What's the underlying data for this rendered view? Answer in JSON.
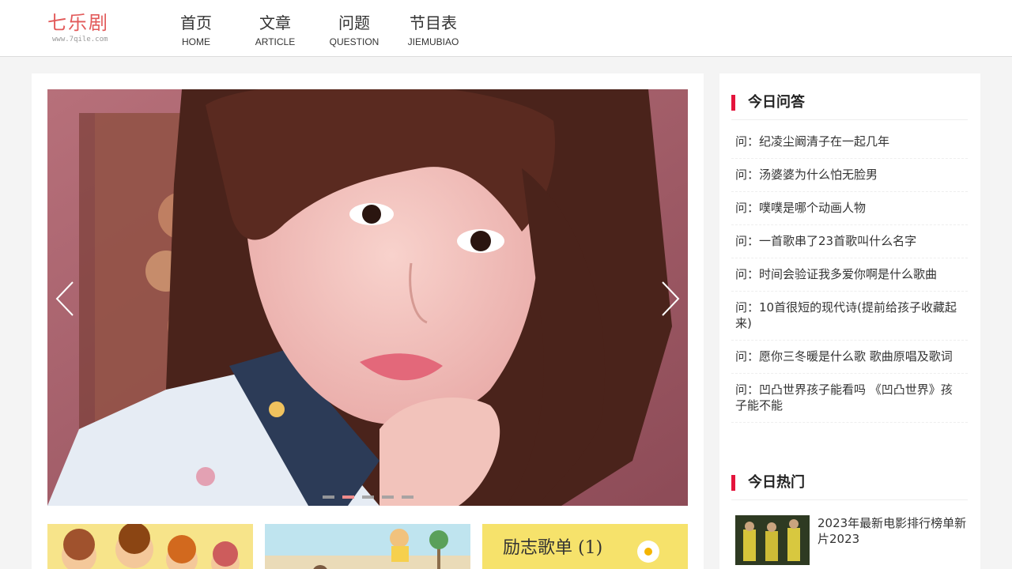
{
  "logo": {
    "name": "七乐剧",
    "url": "www.7qile.com"
  },
  "nav": [
    {
      "cn": "首页",
      "en": "HOME"
    },
    {
      "cn": "文章",
      "en": "ARTICLE"
    },
    {
      "cn": "问题",
      "en": "QUESTION"
    },
    {
      "cn": "节目表",
      "en": "JIEMUBIAO"
    }
  ],
  "slider": {
    "total_slides": 5,
    "active_slide": 2
  },
  "thumbs": [
    {
      "alt": "cartoon children"
    },
    {
      "alt": "beach illustration"
    },
    {
      "title": "励志歌单 (1)"
    }
  ],
  "sidebar": {
    "qa_title": "今日问答",
    "qa": [
      "问：纪凌尘阚清子在一起几年",
      "问：汤婆婆为什么怕无脸男",
      "问：噗噗是哪个动画人物",
      "问：一首歌串了23首歌叫什么名字",
      "问：时间会验证我多爱你啊是什么歌曲",
      "问：10首很短的现代诗(提前给孩子收藏起来)",
      "问：愿你三冬暖是什么歌 歌曲原唱及歌词",
      "问：凹凸世界孩子能看吗 《凹凸世界》孩子能不能"
    ],
    "hot_title": "今日热门",
    "hot": [
      {
        "title": "2023年最新电影排行榜单新片2023"
      }
    ]
  },
  "colors": {
    "accent": "#e4143c",
    "logo": "#e25a5a",
    "dot_active": "#f08b8b"
  }
}
